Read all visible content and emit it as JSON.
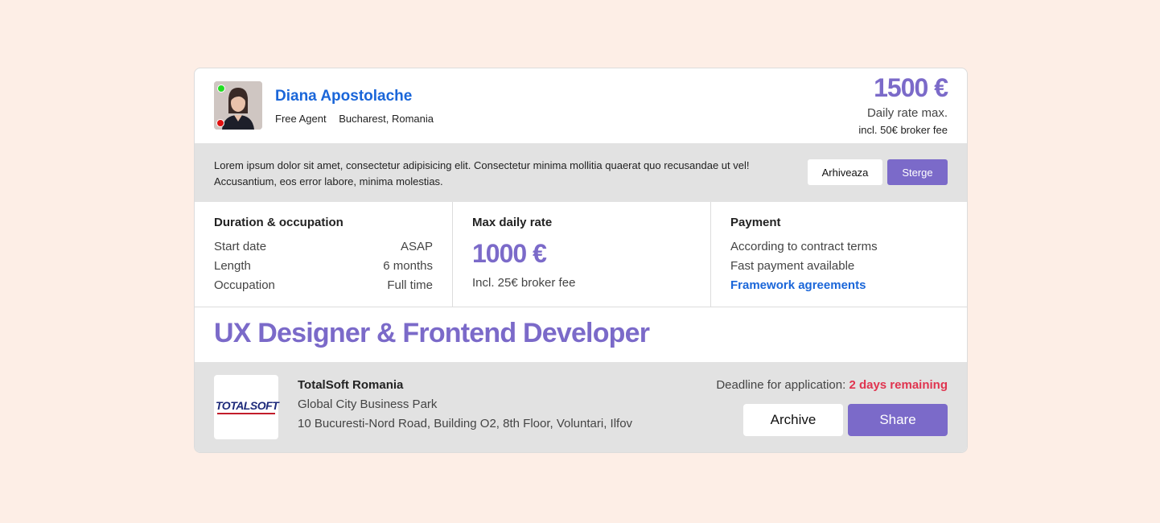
{
  "agent": {
    "name": "Diana Apostolache",
    "role": "Free Agent",
    "location": "Bucharest, Romania",
    "status_colors": {
      "online": "#22dd22",
      "alert": "#e01010"
    }
  },
  "rate": {
    "amount": "1500 €",
    "label": "Daily rate max.",
    "fee": "incl. 50€ broker fee"
  },
  "message": {
    "text": "Lorem ipsum dolor sit amet, consectetur adipisicing elit. Consectetur minima mollitia quaerat quo recusandae ut vel! Accusantium, eos error labore, minima molestias.",
    "archive_label": "Arhiveaza",
    "delete_label": "Sterge"
  },
  "duration": {
    "title": "Duration & occupation",
    "rows": [
      {
        "label": "Start date",
        "value": "ASAP"
      },
      {
        "label": "Length",
        "value": "6 months"
      },
      {
        "label": "Occupation",
        "value": "Full time"
      }
    ]
  },
  "max_rate": {
    "title": "Max daily rate",
    "amount": "1000 €",
    "fee": "Incl. 25€ broker fee"
  },
  "payment": {
    "title": "Payment",
    "line1": "According to contract terms",
    "line2": "Fast payment available",
    "link": "Framework agreements"
  },
  "job": {
    "title": "UX Designer & Frontend Developer"
  },
  "company": {
    "logo_text": "TOTALSOFT",
    "name": "TotalSoft Romania",
    "address1": "Global City Business Park",
    "address2": "10 Bucuresti-Nord Road, Building O2, 8th Floor, Voluntari, Ilfov"
  },
  "deadline": {
    "label": "Deadline for application:",
    "value": "2 days remaining"
  },
  "actions": {
    "archive_label": "Archive",
    "share_label": "Share"
  },
  "colors": {
    "accent": "#7b6ac9",
    "link": "#1a66d9",
    "deadline": "#e0344f",
    "page_bg": "#fdeee6",
    "band_bg": "#e2e2e2"
  }
}
